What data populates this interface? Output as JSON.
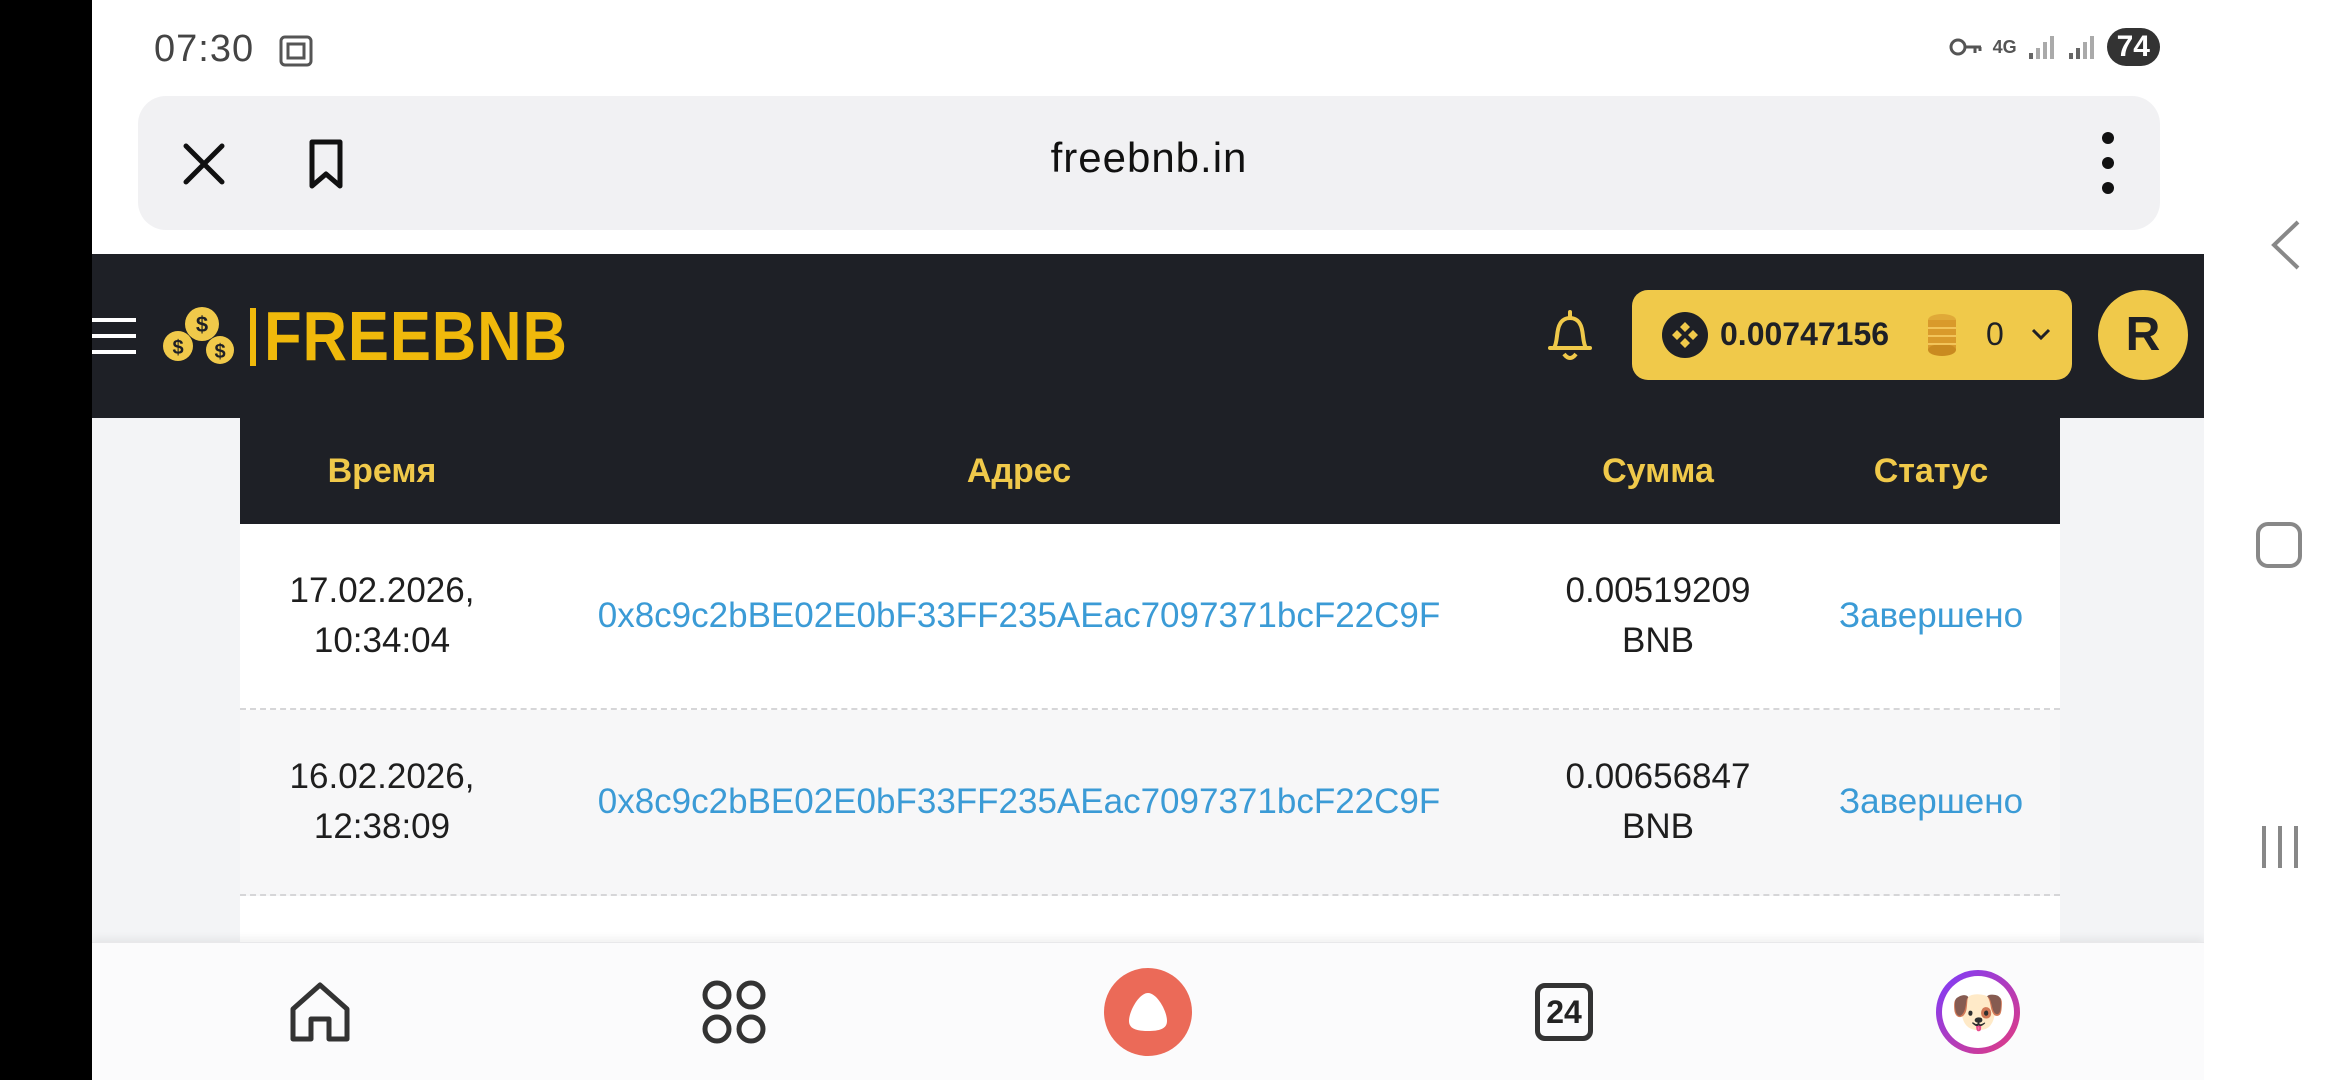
{
  "status_bar": {
    "time": "07:30",
    "network": "4G",
    "battery": "74"
  },
  "browser": {
    "url": "freebnb.in"
  },
  "site": {
    "logo_text": "FREEBNB",
    "balance": "0.00747156",
    "coins": "0",
    "avatar_letter": "R",
    "accent_color": "#f0c94a",
    "header_bg": "#1e2026"
  },
  "table": {
    "headers": {
      "time": "Время",
      "address": "Адрес",
      "sum": "Сумма",
      "status": "Статус"
    },
    "rows": [
      {
        "time": "17.02.2026,\n10:34:04",
        "address": "0x8c9c2bBE02E0bF33FF235AEac7097371bcF22C9F",
        "sum": "0.00519209\nBNB",
        "status": "Завершено"
      },
      {
        "time": "16.02.2026,\n12:38:09",
        "address": "0x8c9c2bBE02E0bF33FF235AEac7097371bcF22C9F",
        "sum": "0.00656847\nBNB",
        "status": "Завершено"
      }
    ]
  },
  "bottom_nav": {
    "calendar_day": "24"
  },
  "icons": {
    "close": "close-icon",
    "bookmark": "bookmark-icon",
    "more": "more-vertical-icon",
    "menu": "hamburger-icon",
    "bell": "bell-icon",
    "home": "home-icon",
    "apps": "apps-grid-icon",
    "assistant": "alice-icon",
    "calendar": "calendar-icon"
  }
}
